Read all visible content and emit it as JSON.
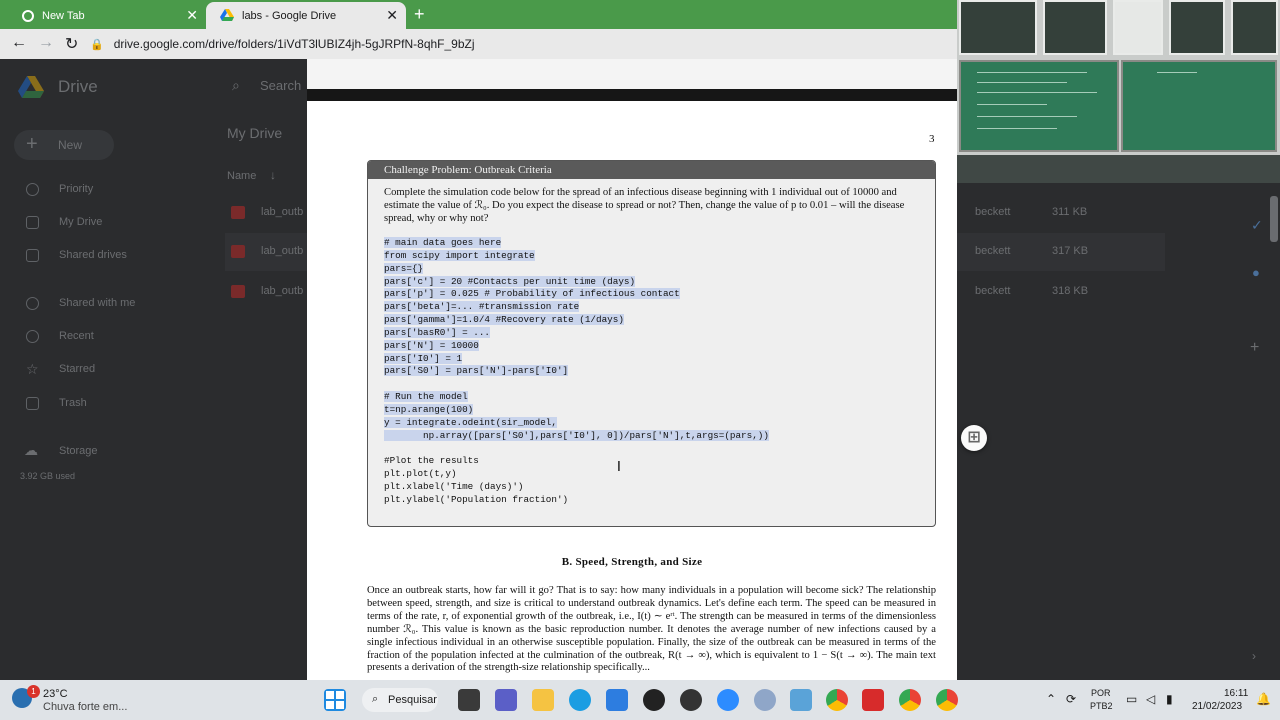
{
  "browser": {
    "tabs": [
      {
        "label": "New Tab"
      },
      {
        "label": "labs - Google Drive"
      }
    ],
    "url": "drive.google.com/drive/folders/1iVdT3lUBIZ4jh-5gJRPfN-8qhF_9bZj"
  },
  "drive": {
    "logo_text": "Drive",
    "search_placeholder": "Search",
    "new_label": "New",
    "title": "My Drive",
    "column_name": "Name",
    "sidebar": [
      {
        "label": "Priority"
      },
      {
        "label": "My Drive"
      },
      {
        "label": "Shared drives"
      },
      {
        "label": "Shared with me"
      },
      {
        "label": "Recent"
      },
      {
        "label": "Starred"
      },
      {
        "label": "Trash"
      },
      {
        "label": "Storage"
      }
    ],
    "storage_used": "3.92 GB used",
    "files": [
      {
        "name": "lab_outb",
        "owner": "beckett",
        "size": "311 KB"
      },
      {
        "name": "lab_outb",
        "owner": "beckett",
        "size": "317 KB"
      },
      {
        "name": "lab_outb",
        "owner": "beckett",
        "size": "318 KB"
      }
    ]
  },
  "pdf": {
    "page_number": "3",
    "challenge_title": "Challenge Problem: Outbreak Criteria",
    "challenge_text": "Complete the simulation code below for the spread of an infectious disease beginning with 1 individual out of 10000 and estimate the value of ℛ₀. Do you expect the disease to spread or not? Then, change the value of p to 0.01 – will the disease spread, why or why not?",
    "code_lines": [
      "# main data goes here",
      "from scipy import integrate",
      "pars={}",
      "pars['c'] = 20 #Contacts per unit time (days)",
      "pars['p'] = 0.025 # Probability of infectious contact",
      "pars['beta']=... #transmission rate",
      "pars['gamma']=1.0/4 #Recovery rate (1/days)",
      "pars['basR0'] = ...",
      "pars['N'] = 10000",
      "pars['I0'] = 1",
      "pars['S0'] = pars['N']-pars['I0']",
      "",
      "# Run the model",
      "t=np.arange(100)",
      "y = integrate.odeint(sir_model,",
      "       np.array([pars['S0'],pars['I0'], 0])/pars['N'],t,args=(pars,))",
      "",
      "#Plot the results",
      "plt.plot(t,y)",
      "plt.xlabel('Time (days)')",
      "plt.ylabel('Population fraction')"
    ],
    "section_title": "B.   Speed, Strength, and Size",
    "section_body": "Once an outbreak starts, how far will it go? That is to say: how many individuals in a population will become sick? The relationship between speed, strength, and size is critical to understand outbreak dynamics. Let's define each term. The speed can be measured in terms of the rate, r, of exponential growth of the outbreak, i.e., I(t) ∼ eʳᵗ. The strength can be measured in terms of the dimensionless number ℛ₀. This value is known as the basic reproduction number. It denotes the average number of new infections caused by a single infectious individual in an otherwise susceptible population. Finally, the size of the outbreak can be measured in terms of the fraction of the population infected at the culmination of the outbreak, R(t → ∞), which is equivalent to 1 − S(t → ∞). The main text presents a derivation of the strength-size relationship specifically..."
  },
  "taskbar": {
    "weather_temp": "23°C",
    "weather_desc": "Chuva forte em...",
    "weather_badge": "1",
    "search_label": "Pesquisar",
    "lang_top": "POR",
    "lang_bottom": "PTB2",
    "time": "16:11",
    "date": "21/02/2023"
  },
  "colors": {
    "tabbar": "#4a9a4a",
    "chrome": "#e9e9e9",
    "drive_bg": "#2b2c2e",
    "highlight": "#c9d4ec",
    "box_header": "#5a5a5a"
  }
}
